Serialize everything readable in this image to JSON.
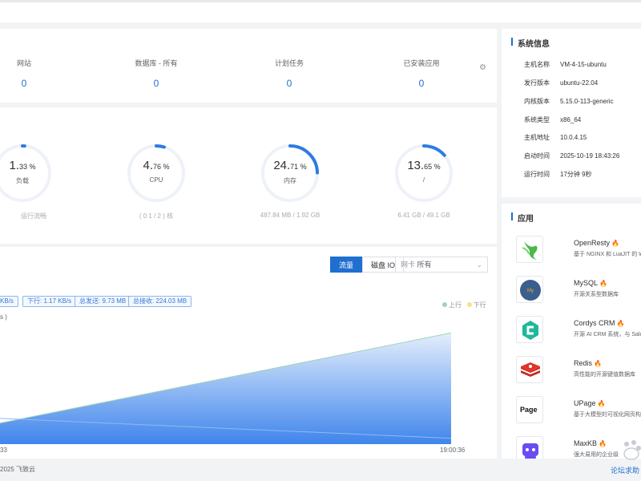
{
  "overview": {
    "items": [
      {
        "label": "网站",
        "value": "0"
      },
      {
        "label": "数据库 - 所有",
        "value": "0"
      },
      {
        "label": "计划任务",
        "value": "0"
      },
      {
        "label": "已安装应用",
        "value": "0"
      }
    ]
  },
  "status": {
    "gauges": [
      {
        "num": "1.",
        "dec": "33 %",
        "label": "负载",
        "sub": "运行流畅",
        "percent": 1.33
      },
      {
        "num": "4.",
        "dec": "76 %",
        "label": "CPU",
        "sub": "( 0 1 / 2 ) 核",
        "percent": 4.76
      },
      {
        "num": "24.",
        "dec": "71 %",
        "label": "内存",
        "sub": "487.84 MB / 1.92 GB",
        "percent": 24.71
      },
      {
        "num": "13.",
        "dec": "65 %",
        "label": "/",
        "sub": "6.41 GB / 49.1 GB",
        "percent": 13.65
      }
    ]
  },
  "traffic": {
    "tab_flow": "流量",
    "tab_disk": "磁盘 IO",
    "nic_label": "网卡",
    "nic_value": "所有",
    "tags": [
      "KB/s",
      "下行: 1.17 KB/s",
      "总发送: 9.73 MB",
      "总接收: 224.03 MB"
    ],
    "legend_up": "上行",
    "legend_down": "下行",
    "ylabel": "s )",
    "x_start": "33",
    "x_end": "19:00:36"
  },
  "chart_data": {
    "type": "area",
    "x": [
      "…33",
      "19:00:36"
    ],
    "series": [
      {
        "name": "上行",
        "values": [
          0.18,
          0.95
        ]
      },
      {
        "name": "下行",
        "values": [
          0.22,
          0.05
        ]
      }
    ]
  },
  "footer": {
    "copyright": "2025 飞致云",
    "forum": "论坛求助"
  },
  "sysinfo": {
    "title": "系统信息",
    "rows": [
      {
        "k": "主机名称",
        "v": "VM-4-15-ubuntu"
      },
      {
        "k": "发行版本",
        "v": "ubuntu-22.04"
      },
      {
        "k": "内核版本",
        "v": "5.15.0-113-generic"
      },
      {
        "k": "系统类型",
        "v": "x86_64"
      },
      {
        "k": "主机地址",
        "v": "10.0.4.15"
      },
      {
        "k": "启动时间",
        "v": "2025-10-19 18:43:26"
      },
      {
        "k": "运行时间",
        "v": "17分钟 9秒"
      }
    ]
  },
  "apps": {
    "title": "应用",
    "items": [
      {
        "name": "OpenResty",
        "desc": "基于 NGINX 和 LuaJIT 的 W",
        "icon": "openresty-logo"
      },
      {
        "name": "MySQL",
        "desc": "开源关系型数据库",
        "icon": "mysql-logo"
      },
      {
        "name": "Cordys CRM",
        "desc": "开源 AI CRM 系统，与 Sale",
        "icon": "cordys-logo"
      },
      {
        "name": "Redis",
        "desc": "高性能的开源键值数据库",
        "icon": "redis-logo"
      },
      {
        "name": "UPage",
        "desc": "基于大模型的可视化网页构",
        "icon": "upage-logo"
      },
      {
        "name": "MaxKB",
        "desc": "强大易用的企业级",
        "icon": "maxkb-logo"
      }
    ],
    "upage_text": "Page"
  },
  "colors": {
    "accent": "#1f6fd1",
    "fire": "#f08a24"
  }
}
